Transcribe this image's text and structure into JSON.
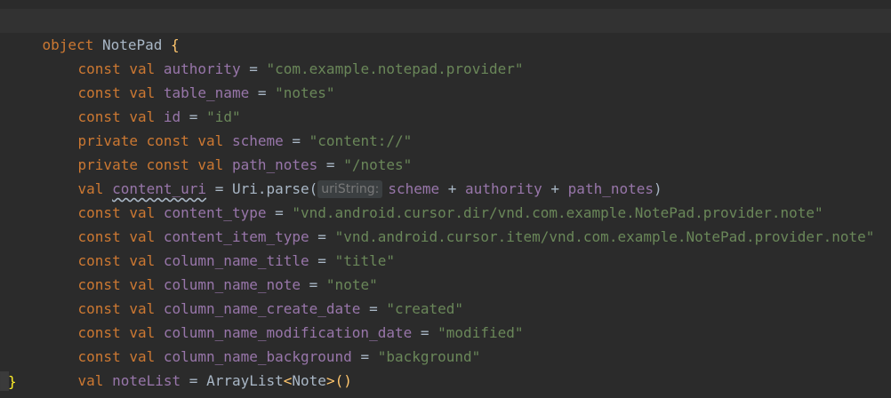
{
  "code": {
    "line1": {
      "kw": "object",
      "name": "NotePad",
      "brace": "{"
    },
    "line2": {
      "kw": "const val",
      "name": "authority",
      "eq": "=",
      "value": "\"com.example.notepad.provider\""
    },
    "line3": {
      "kw": "const val",
      "name": "table_name",
      "eq": "=",
      "value": "\"notes\""
    },
    "line4": {
      "kw": "const val",
      "name": "id",
      "eq": "=",
      "value": "\"id\""
    },
    "line5": {
      "kw": "private const val",
      "name": "scheme",
      "eq": "=",
      "value": "\"content://\""
    },
    "line6": {
      "kw": "private const val",
      "name": "path_notes",
      "eq": "=",
      "value": "\"/notes\""
    },
    "line7": {
      "kw": "val",
      "name": "content_uri",
      "eq": "=",
      "call": "Uri.parse(",
      "hint": "uriString:",
      "arg1": "scheme",
      "plus1": "+",
      "arg2": "authority",
      "plus2": "+",
      "arg3": "path_notes",
      "close": ")"
    },
    "line8": {
      "kw": "const val",
      "name": "content_type",
      "eq": "=",
      "value": "\"vnd.android.cursor.dir/vnd.com.example.NotePad.provider.note\""
    },
    "line9": {
      "kw": "const val",
      "name": "content_item_type",
      "eq": "=",
      "value": "\"vnd.android.cursor.item/vnd.com.example.NotePad.provider.note\""
    },
    "line10": {
      "kw": "const val",
      "name": "column_name_title",
      "eq": "=",
      "value": "\"title\""
    },
    "line11": {
      "kw": "const val",
      "name": "column_name_note",
      "eq": "=",
      "value": "\"note\""
    },
    "line12": {
      "kw": "const val",
      "name": "column_name_create_date",
      "eq": "=",
      "value": "\"created\""
    },
    "line13": {
      "kw": "const val",
      "name": "column_name_modification_date",
      "eq": "=",
      "value": "\"modified\""
    },
    "line14": {
      "kw": "const val",
      "name": "column_name_background",
      "eq": "=",
      "value": "\"background\""
    },
    "line15": {
      "kw": "val",
      "name": "noteList",
      "eq": "=",
      "type": "ArrayList",
      "lt": "<",
      "generic": "Note",
      "gt": ">",
      "parens": "()"
    },
    "line16": {
      "brace": "}"
    }
  },
  "colors": {
    "background": "#2b2b2b",
    "keyword": "#cc7832",
    "string": "#6a8759",
    "property": "#9876aa",
    "text": "#a9b7c6",
    "brace": "#ffc66d"
  }
}
